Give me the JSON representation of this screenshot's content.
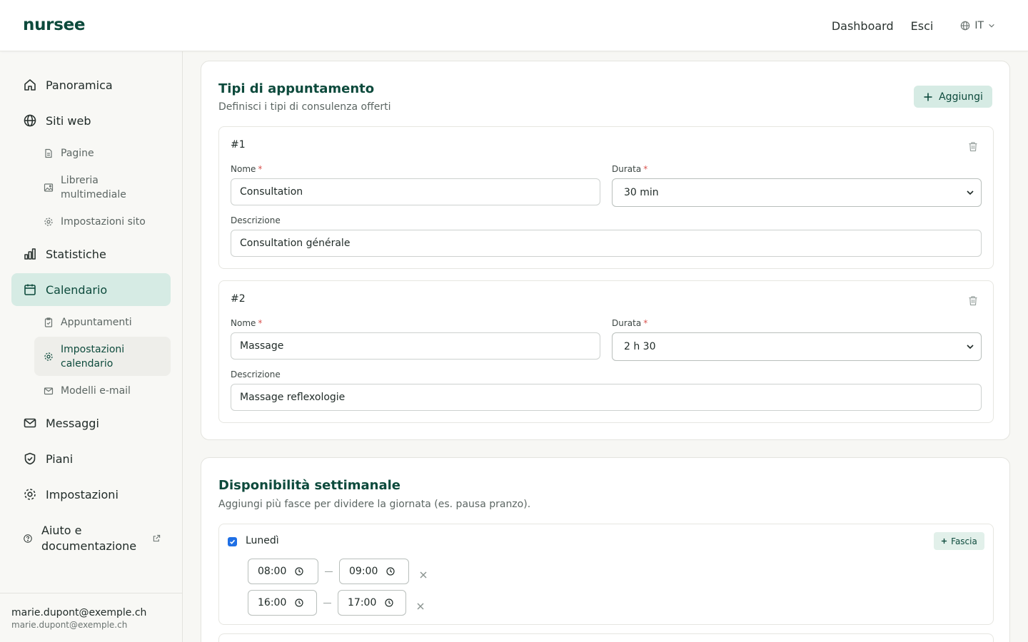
{
  "header": {
    "logo": "nursee",
    "nav": {
      "dashboard": "Dashboard",
      "logout": "Esci"
    },
    "language": "IT"
  },
  "sidebar": {
    "items": [
      {
        "label": "Panoramica",
        "icon": "home-icon"
      },
      {
        "label": "Siti web",
        "icon": "globe-icon"
      },
      {
        "label": "Statistiche",
        "icon": "bar-chart-icon"
      },
      {
        "label": "Calendario",
        "icon": "calendar-icon",
        "active": true
      },
      {
        "label": "Messaggi",
        "icon": "mail-icon"
      },
      {
        "label": "Piani",
        "icon": "shield-check-icon"
      },
      {
        "label": "Impostazioni",
        "icon": "gear-icon"
      },
      {
        "label": "Aiuto e documentazione",
        "icon": "help-circle-icon",
        "external": true
      }
    ],
    "websites_sub": [
      {
        "label": "Pagine",
        "icon": "file-icon"
      },
      {
        "label": "Libreria multimediale",
        "icon": "image-icon"
      },
      {
        "label": "Impostazioni sito",
        "icon": "gear-icon"
      }
    ],
    "calendar_sub": [
      {
        "label": "Appuntamenti",
        "icon": "clipboard-check-icon"
      },
      {
        "label": "Impostazioni calendario",
        "icon": "gear-icon",
        "active": true
      },
      {
        "label": "Modelli e-mail",
        "icon": "mail-icon"
      }
    ],
    "user": {
      "name": "marie.dupont@exemple.ch",
      "email": "marie.dupont@exemple.ch"
    }
  },
  "appointment_types": {
    "title": "Tipi di appuntamento",
    "subtitle": "Definisci i tipi di consulenza offerti",
    "add_label": "Aggiungi",
    "name_label": "Nome",
    "duration_label": "Durata",
    "description_label": "Descrizione",
    "required_mark": "*",
    "items": [
      {
        "number": "#1",
        "name": "Consultation",
        "duration": "30 min",
        "description": "Consultation générale"
      },
      {
        "number": "#2",
        "name": "Massage",
        "duration": "2 h 30",
        "description": "Massage reflexologie"
      }
    ]
  },
  "weekly_availability": {
    "title": "Disponibilità settimanale",
    "subtitle": "Aggiungi più fasce per dividere la giornata (es. pausa pranzo).",
    "add_slot_label": "Fascia",
    "days": [
      {
        "name": "Lunedì",
        "enabled": true,
        "slots": [
          {
            "start": "08:00",
            "end": "09:00"
          },
          {
            "start": "16:00",
            "end": "17:00"
          }
        ]
      }
    ]
  },
  "colors": {
    "brand": "#0d4a3c",
    "active_nav_bg": "#d6ebe4",
    "required": "#d9534f",
    "checkbox": "#1f6fe5"
  }
}
